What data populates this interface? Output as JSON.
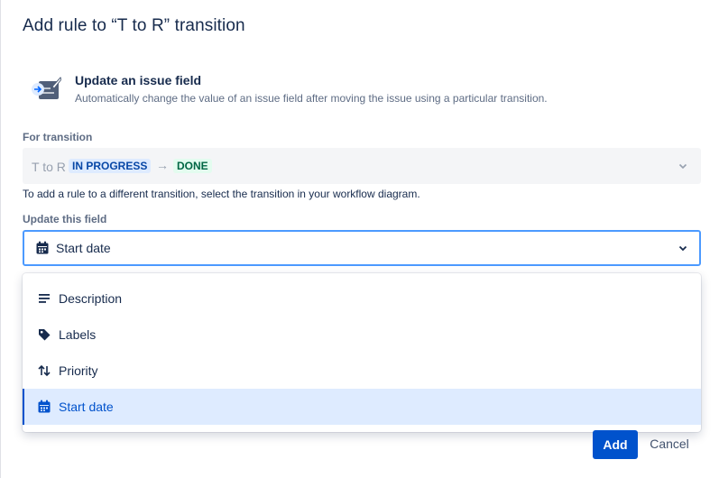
{
  "dialog": {
    "title": "Add rule to “T to R” transition"
  },
  "rule": {
    "icon": "update-field-icon",
    "title": "Update an issue field",
    "description": "Automatically change the value of an issue field after moving the issue using a particular transition."
  },
  "transition": {
    "label": "For transition",
    "prefix": "T to R",
    "from_status": "IN PROGRESS",
    "arrow": "→",
    "to_status": "DONE",
    "hint": "To add a rule to a different transition, select the transition in your workflow diagram."
  },
  "field": {
    "label": "Update this field",
    "selected_value": "Start date",
    "selected_icon": "calendar-icon",
    "options": [
      {
        "label": "Description",
        "icon": "text-lines-icon"
      },
      {
        "label": "Labels",
        "icon": "tag-icon"
      },
      {
        "label": "Priority",
        "icon": "priority-arrows-icon"
      },
      {
        "label": "Start date",
        "icon": "calendar-icon",
        "selected": true
      }
    ]
  },
  "footer": {
    "add_label": "Add",
    "cancel_label": "Cancel"
  },
  "colors": {
    "primary": "#0052cc",
    "focus_border": "#4c9aff",
    "selected_bg": "#deebff",
    "in_progress_bg": "#deebff",
    "in_progress_text": "#0747a6",
    "done_bg": "#e3fcef",
    "done_text": "#006644"
  }
}
